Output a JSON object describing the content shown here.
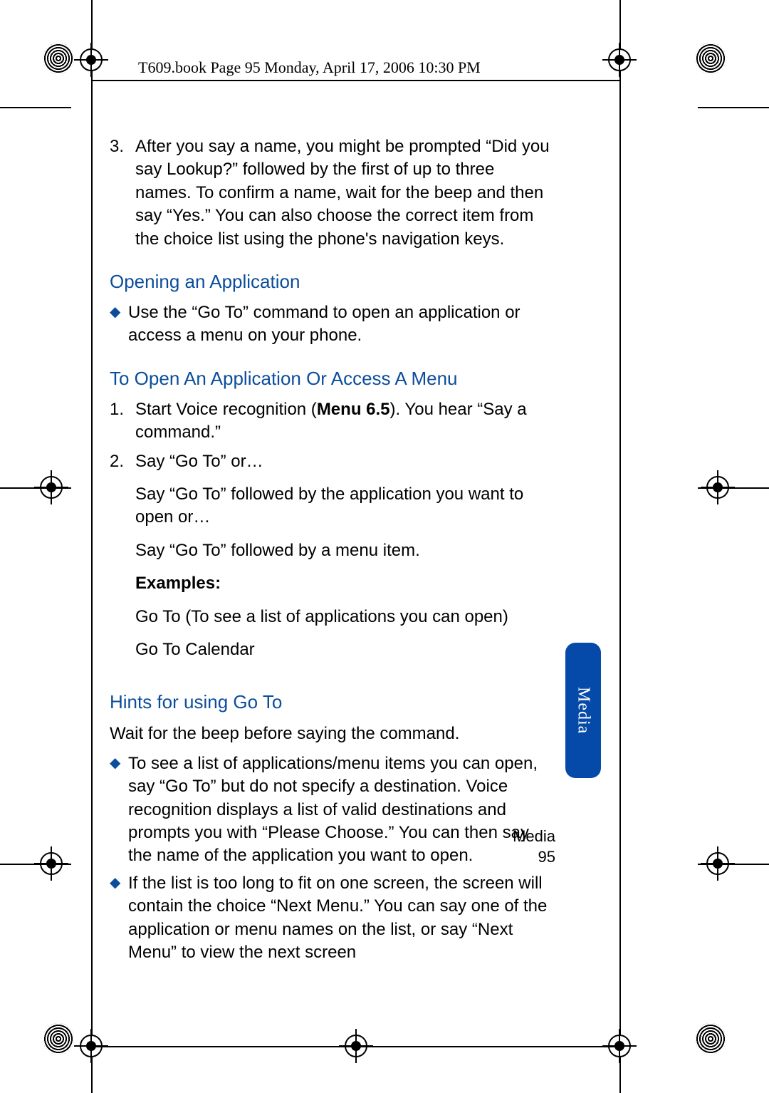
{
  "header": "T609.book  Page 95  Monday, April 17, 2006  10:30 PM",
  "step3_num": "3.",
  "step3_text": "After you say a name, you might be prompted “Did you say Lookup?” followed by the first of up to three names. To confirm a name, wait for the beep and then say “Yes.” You can also choose the correct item from the choice list using the phone's navigation keys.",
  "heading1": "Opening an Application",
  "bullet1": "Use the “Go To” command to open an application or access a menu on your phone.",
  "heading2": "To Open An Application Or Access A Menu",
  "ol1_num": "1.",
  "ol1_pre": "Start Voice recognition (",
  "ol1_bold": "Menu 6.5",
  "ol1_post": "). You hear “Say a command.”",
  "ol2_num": "2.",
  "ol2_line1": "Say “Go To” or…",
  "ol2_line2": "Say “Go To” followed by the application you want to open or…",
  "ol2_line3": "Say “Go To” followed by a menu item.",
  "examples_label": "Examples:",
  "example1": "Go To (To see a list of applications you can open)",
  "example2": "Go To Calendar",
  "heading3": "Hints for using Go To",
  "hints_intro": "Wait for the beep before saying the command.",
  "hint_bullet1": "To see a list of applications/menu items you can open, say “Go To” but do not specify a destination. Voice recognition displays a list of valid destinations and prompts you with “Please Choose.” You can then say the name of the application you want to open.",
  "hint_bullet2": "If the list is too long to fit on one screen, the screen will contain the choice “Next Menu.” You can say one of the application or menu names on the list, or say “Next Menu” to view the next screen",
  "footer_label": "Media",
  "footer_page": "95",
  "sidetab": "Media"
}
